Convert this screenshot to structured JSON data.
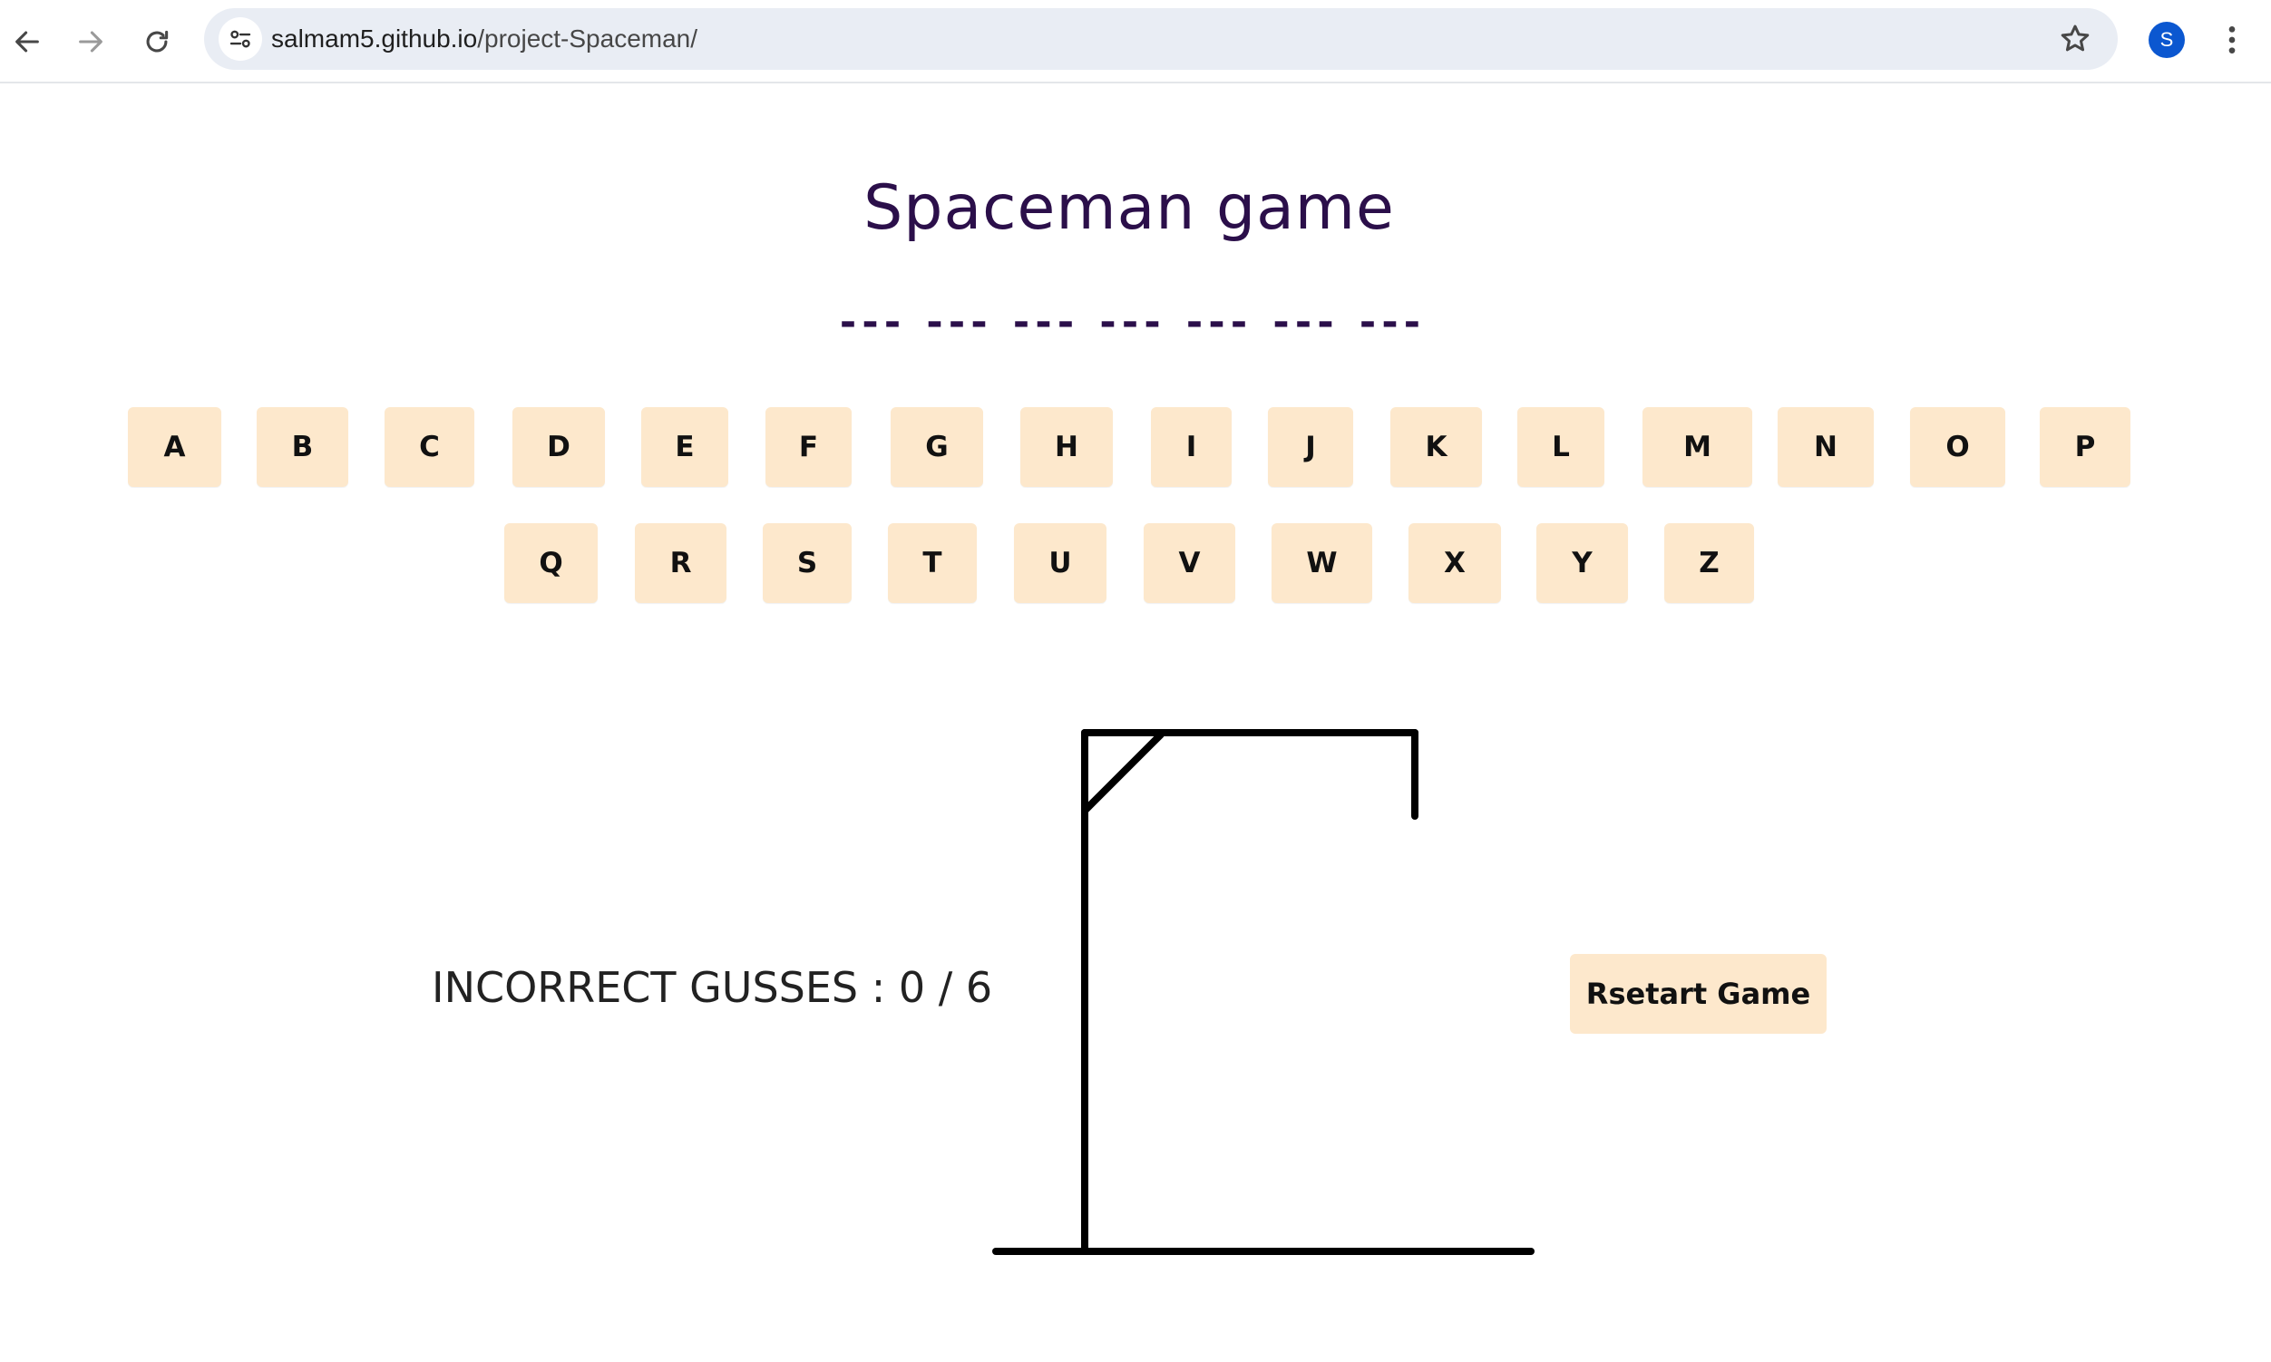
{
  "browser": {
    "url_domain": "salmam5.github.io",
    "url_path": "/project-Spaceman/",
    "profile_initial": "S",
    "back_icon": "arrow-left-icon",
    "forward_icon": "arrow-right-icon",
    "reload_icon": "reload-icon",
    "site_info_icon": "tune-icon",
    "bookmark_icon": "star-icon",
    "menu_icon": "kebab-menu-icon"
  },
  "game": {
    "title": "Spaceman game",
    "word_slots": [
      "---",
      "---",
      "---",
      "---",
      "---",
      "---",
      "---"
    ],
    "letters_row1": [
      "A",
      "B",
      "C",
      "D",
      "E",
      "F",
      "G",
      "H",
      "I",
      "J",
      "K",
      "L",
      "M",
      "N",
      "O",
      "P"
    ],
    "letters_row2": [
      "Q",
      "R",
      "S",
      "T",
      "U",
      "V",
      "W",
      "X",
      "Y",
      "Z"
    ],
    "incorrect_guesses_text": "INCORRECT GUSSES : 0 / 6",
    "incorrect_count": 0,
    "max_incorrect": 6,
    "restart_label": "Rsetart Game",
    "key_color": "#fde8cc",
    "title_color": "#2b0f4a"
  }
}
